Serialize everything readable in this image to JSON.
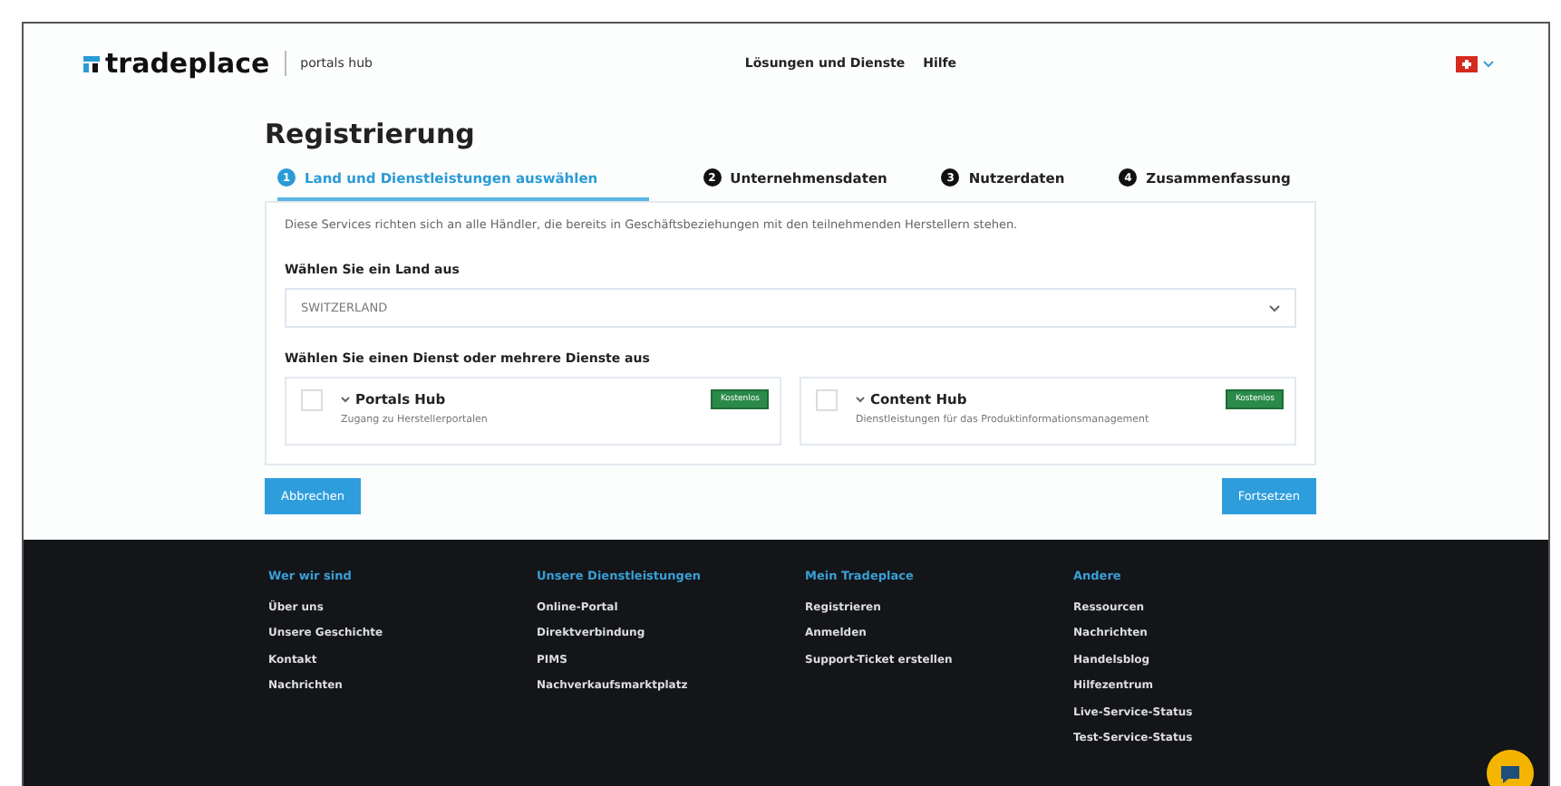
{
  "header": {
    "logo": "tradeplace",
    "product": "portals hub",
    "nav": [
      "Lösungen und Dienste",
      "Hilfe"
    ]
  },
  "title": "Registrierung",
  "steps": [
    {
      "number": "1",
      "label": "Land und Dienstleistungen auswählen",
      "selected": true
    },
    {
      "number": "2",
      "label": "Unternehmensdaten",
      "selected": false
    },
    {
      "number": "3",
      "label": "Nutzerdaten",
      "selected": false
    },
    {
      "number": "4",
      "label": "Zusammenfassung",
      "selected": false
    }
  ],
  "intro": "Diese Services richten sich an alle Händler, die bereits in Geschäftsbeziehungen mit den teilnehmenden Herstellern stehen.",
  "country": {
    "label": "Wählen Sie ein Land aus",
    "value": "SWITZERLAND"
  },
  "services_label": "Wählen Sie einen Dienst oder mehrere Dienste aus",
  "services": [
    {
      "name": "Portals Hub",
      "description": "Zugang zu Herstellerportalen",
      "badge": "Kostenlos",
      "checked": false
    },
    {
      "name": "Content Hub",
      "description": "Dienstleistungen für das Produktinformationsmanagement",
      "badge": "Kostenlos",
      "checked": false
    }
  ],
  "buttons": {
    "cancel": "Abbrechen",
    "next": "Fortsetzen"
  },
  "footer": [
    {
      "heading": "Wer wir sind",
      "links": [
        "Über uns",
        "Unsere Geschichte",
        "Kontakt",
        "Nachrichten"
      ]
    },
    {
      "heading": "Unsere Dienstleistungen",
      "links": [
        "Online-Portal",
        "Direktverbindung",
        "PIMS",
        "Nachverkaufsmarktplatz"
      ]
    },
    {
      "heading": "Mein Tradeplace",
      "links": [
        "Registrieren",
        "Anmelden",
        "Support-Ticket erstellen"
      ]
    },
    {
      "heading": "Andere",
      "links": [
        "Ressourcen",
        "Nachrichten",
        "Handelsblog",
        "Hilfezentrum",
        "Live-Service-Status",
        "Test-Service-Status"
      ]
    }
  ]
}
